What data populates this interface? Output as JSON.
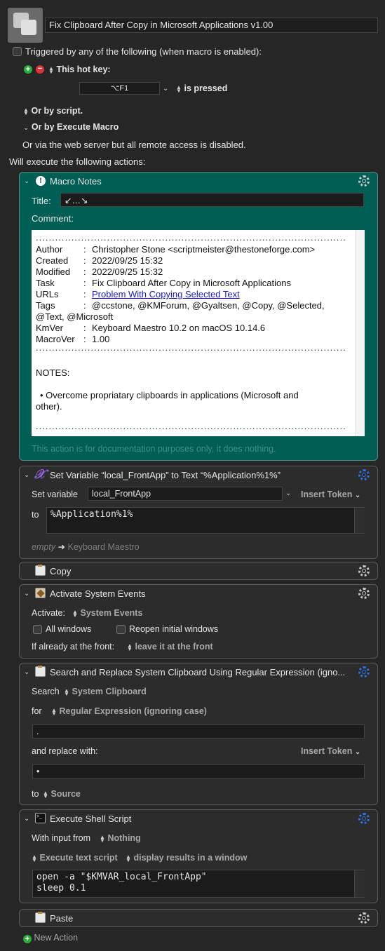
{
  "header": {
    "macro_name": "Fix Clipboard After Copy in Microsoft Applications v1.00",
    "triggered_label": "Triggered by any of the following (when macro is enabled):",
    "hotkey_label": "This hot key:",
    "hotkey_value": "⌥F1",
    "is_pressed": "is pressed",
    "or_by_script": "Or by script.",
    "or_by_execute": "Or by Execute Macro",
    "web_server": "Or via the web server but all remote access is disabled.",
    "will_execute": "Will execute the following actions:"
  },
  "notes": {
    "title_label": "Macro Notes",
    "title_field_label": "Title:",
    "title_value": "↙…↘",
    "comment_label": "Comment:",
    "dots": "......................................................................................................",
    "rows": [
      {
        "k": "Author",
        "v": "Christopher Stone <scriptmeister@thestoneforge.com>"
      },
      {
        "k": "Created",
        "v": "2022/09/25 15:32"
      },
      {
        "k": "Modified",
        "v": "2022/09/25 15:32"
      },
      {
        "k": "Task",
        "v": "Fix Clipboard After Copy in Microsoft Applications"
      },
      {
        "k": "URLs",
        "v": "Problem With Copying Selected Text"
      },
      {
        "k": "Tags",
        "v": "@ccstone, @KMForum, @Gyaltsen, @Copy, @Selected,"
      },
      {
        "k": "",
        "v": "@Text, @Microsoft"
      },
      {
        "k": "KmVer",
        "v": "Keyboard Maestro 10.2 on macOS 10.14.6"
      },
      {
        "k": "MacroVer",
        "v": "1.00"
      }
    ],
    "notes_heading": "NOTES:",
    "bullet": "Overcome propriatary clipboards in applications (Microsoft and",
    "bullet_cont": "other).",
    "footer": "This action is for documentation purposes only, it does nothing."
  },
  "setvar": {
    "title": "Set Variable “local_FrontApp” to Text “%Application%1%”",
    "set_label": "Set variable",
    "var_name": "local_FrontApp",
    "insert_token": "Insert Token",
    "to_label": "to",
    "text": "%Application%1%",
    "empty": "empty",
    "arrow_text": "Keyboard Maestro"
  },
  "copy": {
    "title": "Copy"
  },
  "activate": {
    "title": "Activate System Events",
    "activate_label": "Activate:",
    "app": "System Events",
    "all_windows": "All windows",
    "reopen": "Reopen initial windows",
    "if_front": "If already at the front:",
    "front_action": "leave it at the front"
  },
  "search": {
    "title": "Search and Replace System Clipboard Using Regular Expression (igno...",
    "search_label": "Search",
    "source": "System Clipboard",
    "for_label": "for",
    "mode": "Regular Expression (ignoring case)",
    "pattern": ".",
    "replace_label": "and replace with:",
    "insert_token": "Insert Token",
    "replacement": "•",
    "to_label": "to",
    "to_value": "Source"
  },
  "shell": {
    "title": "Execute Shell Script",
    "input_label": "With input from",
    "input_value": "Nothing",
    "exec_mode": "Execute text script",
    "display_mode": "display results in a window",
    "script_line1": "open -a \"$KMVAR_local_FrontApp\"",
    "script_line2": "sleep 0.1"
  },
  "paste": {
    "title": "Paste"
  },
  "new_action": "New Action",
  "colors": {
    "notes_bg": "#005e55",
    "link": "#1a1ad6",
    "accent_blue": "#2f6fe0"
  }
}
